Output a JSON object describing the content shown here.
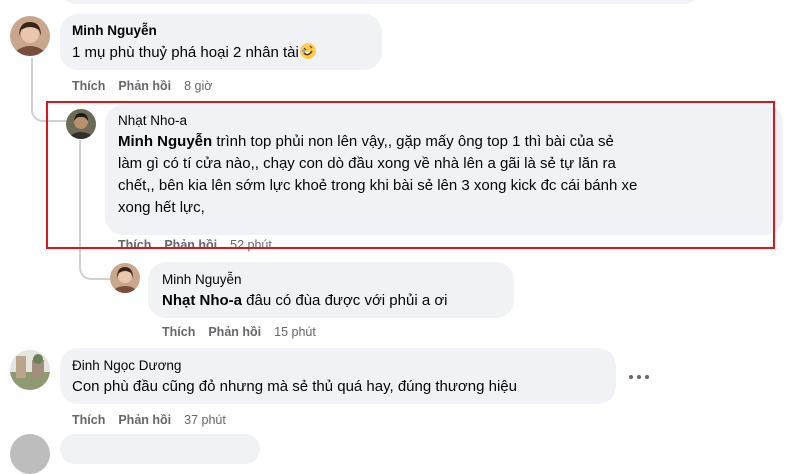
{
  "comments": [
    {
      "author": "Minh Nguyễn",
      "text": "1 mụ phù thuỷ phá hoại 2 nhân tài",
      "emoji": "rolling-on-floor-laughing-emoji",
      "like_label": "Thích",
      "reply_label": "Phản hồi",
      "time": "8 giờ"
    },
    {
      "author": "Nhạt Nho-a",
      "mention": "Minh Nguyễn",
      "lines": [
        " trình top phủi non lên vậy,, gặp mấy ông top 1 thì bài của sẻ",
        "làm gì có tí cửa nào,, chạy con dò đầu xong về nhà lên a gãi là sẻ tự lăn ra",
        "chết,, bên kia lên sớm lực khoẻ trong khi bài sẻ lên 3 xong kick đc cái bánh xe",
        "xong hết lực,"
      ],
      "like_label": "Thích",
      "reply_label": "Phản hồi",
      "time": "52 phút"
    },
    {
      "author": "Minh Nguyễn",
      "mention": "Nhạt Nho-a",
      "text": " đâu có đùa được với phủi a ơi",
      "like_label": "Thích",
      "reply_label": "Phản hồi",
      "time": "15 phút"
    },
    {
      "author": "Đinh Ngọc Dương",
      "text": "Con phù đầu cũng đỏ nhưng mà sẻ thủ quá hay, đúng thương hiệu",
      "like_label": "Thích",
      "reply_label": "Phản hồi",
      "time": "37 phút",
      "more_icon": "more-options-icon"
    }
  ],
  "colors": {
    "bubble": "#f0f2f5",
    "secondary_text": "#65676b",
    "highlight_border": "#e0141c"
  }
}
